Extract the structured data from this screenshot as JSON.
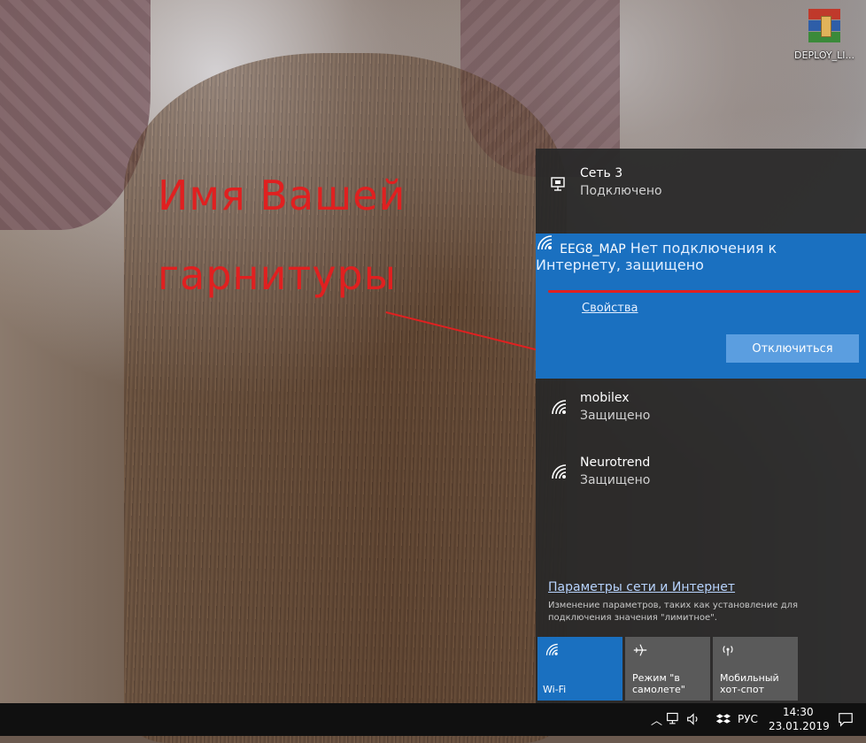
{
  "desktop": {
    "icon_label": "DEPLOY_LI..."
  },
  "annotation": {
    "line1": "Имя Вашей",
    "line2": "гарнитуры"
  },
  "flyout": {
    "wired": {
      "name": "Сеть 3",
      "status": "Подключено"
    },
    "connected": {
      "name": "EEG8_MAP",
      "status": "Нет подключения к Интернету, защищено",
      "properties_link": "Свойства",
      "disconnect_button": "Отключиться"
    },
    "networks": [
      {
        "name": "mobilex",
        "status": "Защищено"
      },
      {
        "name": "Neurotrend",
        "status": "Защищено"
      }
    ],
    "settings_link": "Параметры сети и Интернет",
    "settings_description": "Изменение параметров, таких как установление для подключения значения \"лимитное\".",
    "tiles": [
      {
        "label": "Wi-Fi",
        "icon": "wifi-icon",
        "active": true
      },
      {
        "label": "Режим \"в самолете\"",
        "icon": "airplane-icon",
        "active": false
      },
      {
        "label": "Мобильный хот-спот",
        "icon": "hotspot-icon",
        "active": false
      }
    ]
  },
  "taskbar": {
    "language": "РУС",
    "time": "14:30",
    "date": "23.01.2019"
  },
  "colors": {
    "accent": "#1a70c0",
    "annotation": "#e02020",
    "flyout_bg": "#282828"
  }
}
